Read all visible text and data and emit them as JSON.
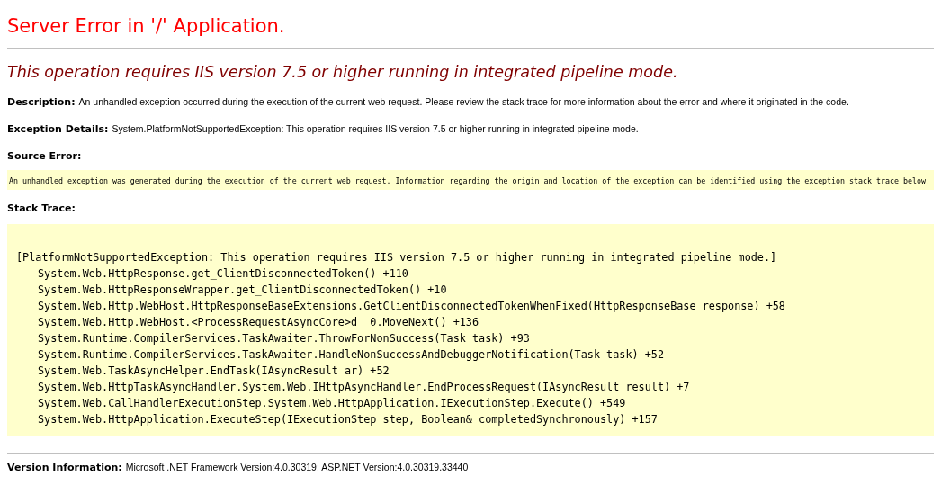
{
  "title": "Server Error in '/' Application.",
  "heading": "This operation requires IIS version 7.5 or higher running in integrated pipeline mode.",
  "description": {
    "label": "Description:",
    "text": "An unhandled exception occurred during the execution of the current web request. Please review the stack trace for more information about the error and where it originated in the code."
  },
  "exception_details": {
    "label": "Exception Details:",
    "text": "System.PlatformNotSupportedException: This operation requires IIS version 7.5 or higher running in integrated pipeline mode."
  },
  "source_error": {
    "label": "Source Error:",
    "text": "An unhandled exception was generated during the execution of the current web request. Information regarding the origin and location of the exception can be identified using the exception stack trace below."
  },
  "stack_trace": {
    "label": "Stack Trace:",
    "exception": "[PlatformNotSupportedException: This operation requires IIS version 7.5 or higher running in integrated pipeline mode.]",
    "frames": [
      "System.Web.HttpResponse.get_ClientDisconnectedToken() +110",
      "System.Web.HttpResponseWrapper.get_ClientDisconnectedToken() +10",
      "System.Web.Http.WebHost.HttpResponseBaseExtensions.GetClientDisconnectedTokenWhenFixed(HttpResponseBase response) +58",
      "System.Web.Http.WebHost.<ProcessRequestAsyncCore>d__0.MoveNext() +136",
      "System.Runtime.CompilerServices.TaskAwaiter.ThrowForNonSuccess(Task task) +93",
      "System.Runtime.CompilerServices.TaskAwaiter.HandleNonSuccessAndDebuggerNotification(Task task) +52",
      "System.Web.TaskAsyncHelper.EndTask(IAsyncResult ar) +52",
      "System.Web.HttpTaskAsyncHandler.System.Web.IHttpAsyncHandler.EndProcessRequest(IAsyncResult result) +7",
      "System.Web.CallHandlerExecutionStep.System.Web.HttpApplication.IExecutionStep.Execute() +549",
      "System.Web.HttpApplication.ExecuteStep(IExecutionStep step, Boolean& completedSynchronously) +157"
    ]
  },
  "version_information": {
    "label": "Version Information:",
    "text": "Microsoft .NET Framework Version:4.0.30319; ASP.NET Version:4.0.30319.33440"
  }
}
